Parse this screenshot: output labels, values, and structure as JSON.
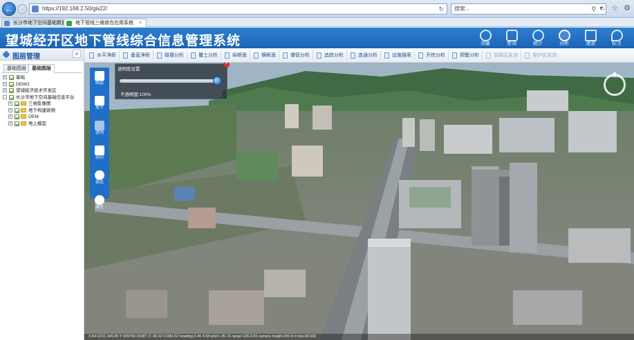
{
  "browser": {
    "address": "https://192.168.2.50/gis22/",
    "search_placeholder": "搜索...",
    "tabs": [
      {
        "label": "长沙市地下空间基础数据平台",
        "active": false
      },
      {
        "label": "地下管线三维综合应用系统",
        "active": true
      }
    ],
    "tab_close": "×"
  },
  "app": {
    "title": "望城经开区地下管线综合信息管理系统",
    "header_tools": [
      {
        "label": "测量",
        "icon": "crosshair-icon",
        "active": false
      },
      {
        "label": "查询",
        "icon": "shield-search-icon",
        "active": false
      },
      {
        "label": "统计",
        "icon": "chart-circle-icon",
        "active": false
      },
      {
        "label": "分析",
        "icon": "analysis-icon",
        "active": true
      },
      {
        "label": "漫游",
        "icon": "columns-icon",
        "active": false
      },
      {
        "label": "标注",
        "icon": "pin-icon",
        "active": false
      }
    ]
  },
  "layer_panel": {
    "title": "图层管理",
    "close": "×",
    "tabs": [
      {
        "label": "基础图层",
        "active": false
      },
      {
        "label": "基础图层",
        "active": true
      }
    ],
    "tree": [
      {
        "label": "基础",
        "level": 0,
        "folder": false
      },
      {
        "label": "DEMO",
        "level": 0,
        "folder": false
      },
      {
        "label": "望城经济技术开发区",
        "level": 0,
        "folder": false
      },
      {
        "label": "长沙市地下空间基础信息平台",
        "level": 0,
        "folder": false
      },
      {
        "label": "三维影像图",
        "level": 1,
        "folder": true
      },
      {
        "label": "地下构建筑物",
        "level": 1,
        "folder": true
      },
      {
        "label": "OEM",
        "level": 1,
        "folder": true
      },
      {
        "label": "地上模型",
        "level": 1,
        "folder": true
      }
    ]
  },
  "toolbar": {
    "items": [
      {
        "label": "水平净距",
        "enabled": true
      },
      {
        "label": "垂直净距",
        "enabled": true
      },
      {
        "label": "碰撞分析",
        "enabled": true
      },
      {
        "label": "覆土分析",
        "enabled": true
      },
      {
        "label": "纵断面",
        "enabled": true
      },
      {
        "label": "横断面",
        "enabled": true
      },
      {
        "label": "爆管分析",
        "enabled": true
      },
      {
        "label": "追踪分析",
        "enabled": true
      },
      {
        "label": "连通分析",
        "enabled": true
      },
      {
        "label": "设施搜索",
        "enabled": true
      },
      {
        "label": "开挖分析",
        "enabled": true
      },
      {
        "label": "预警分析",
        "enabled": true
      },
      {
        "label": "管廊区监测",
        "enabled": false
      },
      {
        "label": "保护区监测",
        "enabled": false
      }
    ]
  },
  "view_tools": [
    {
      "label": "图层",
      "icon": "layers-icon"
    },
    {
      "label": "地下",
      "icon": "underground-icon"
    },
    {
      "label": "透明",
      "icon": "transparency-icon"
    },
    {
      "label": "剖切",
      "icon": "section-icon"
    },
    {
      "label": "指北",
      "icon": "north-icon"
    },
    {
      "label": "属性",
      "icon": "pie-icon"
    }
  ],
  "opacity_dialog": {
    "title": "透明度设置",
    "close": "×",
    "value_text": "不透明度:100%",
    "value": 1.0
  },
  "status": {
    "text": "X:54:2231.346.85    Y:309755.03387    Z:-48.92 0.999.52    heading:3.46 4.94    pitch:-35.15    range:136.3.69    camera height:255.8 m    fps:28.500"
  },
  "colors": {
    "brand": "#1b63b5",
    "toolbar_text": "#1e4d8c",
    "close_red": "#d32a2a"
  }
}
